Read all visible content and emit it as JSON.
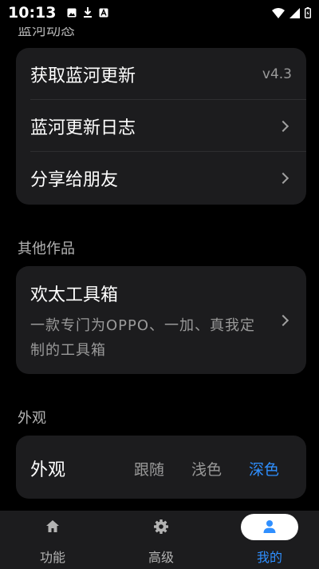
{
  "status_bar": {
    "time": "10:13",
    "left_icons": [
      "image-icon",
      "download-icon",
      "a-badge-icon"
    ],
    "right_icons": [
      "wifi-icon",
      "signal-icon",
      "battery-icon"
    ]
  },
  "sections": {
    "lanhe_updates": {
      "title": "蓝河动态",
      "rows": [
        {
          "label": "获取蓝河更新",
          "value": "v4.3"
        },
        {
          "label": "蓝河更新日志"
        },
        {
          "label": "分享给朋友"
        }
      ]
    },
    "other_works": {
      "title": "其他作品",
      "item": {
        "title": "欢太工具箱",
        "description": "一款专门为OPPO、一加、真我定制的工具箱"
      }
    },
    "appearance": {
      "title": "外观",
      "label": "外观",
      "options": [
        "跟随",
        "浅色",
        "深色"
      ],
      "selected": "深色"
    }
  },
  "bottom_nav": {
    "items": [
      {
        "label": "功能",
        "icon": "home-icon"
      },
      {
        "label": "高级",
        "icon": "gear-icon"
      },
      {
        "label": "我的",
        "icon": "person-icon"
      }
    ],
    "active": "我的"
  },
  "colors": {
    "accent": "#2f8fff",
    "card": "#1c1c1e",
    "background": "#000000"
  }
}
